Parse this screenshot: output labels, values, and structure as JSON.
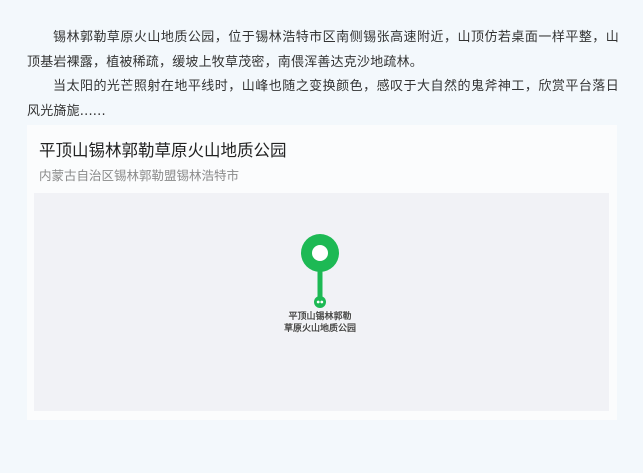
{
  "article": {
    "paragraphs": [
      "锡林郭勒草原火山地质公园，位于锡林浩特市区南侧锡张高速附近，山顶仿若桌面一样平整，山顶基岩裸露，植被稀疏，缓坡上牧草茂密，南偎浑善达克沙地疏林。",
      "当太阳的光芒照射在地平线时，山峰也随之变换颜色，感叹于大自然的鬼斧神工，欣赏平台落日风光旖旎......"
    ]
  },
  "map_card": {
    "title": "平顶山锡林郭勒草原火山地质公园",
    "address": "内蒙古自治区锡林郭勒盟锡林浩特市",
    "marker": {
      "icon": "map-pin-icon",
      "label_line1": "平顶山锡林郭勒",
      "label_line2": "草原火山地质公园",
      "color": "#1db954"
    }
  },
  "colors": {
    "page_background": "#f3f8fc",
    "card_background": "#fbfcfd",
    "map_background": "#f1f2f6",
    "body_text": "#333333",
    "subtitle_text": "#8a8a8a"
  }
}
